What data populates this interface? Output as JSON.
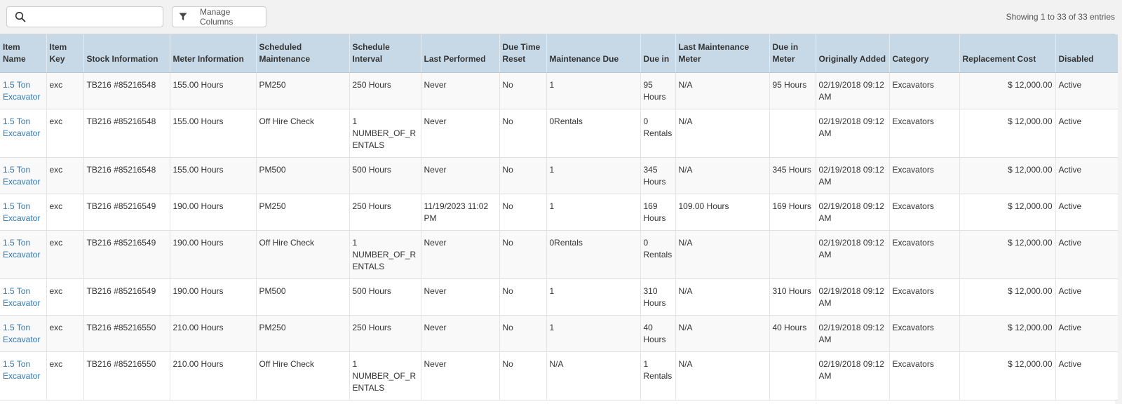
{
  "toolbar": {
    "search_value": "",
    "search_placeholder": "",
    "manage_columns_label": "Manage Columns",
    "entries_info": "Showing 1 to 33 of 33 entries"
  },
  "icons": {
    "search": "search-icon",
    "filter": "filter-icon"
  },
  "colors": {
    "link": "#2a7ab8",
    "header_bg": "#c7d9e6",
    "toolbar_bg": "#f2f2f2"
  },
  "table": {
    "columns": [
      "Item Name",
      "Item Key",
      "Stock Information",
      "Meter Information",
      "Scheduled Maintenance",
      "Schedule Interval",
      "Last Performed",
      "Due Time Reset",
      "Maintenance Due",
      "Due in",
      "Last Maintenance Meter",
      "Due in Meter",
      "Originally Added",
      "Category",
      "Replacement Cost",
      "Disabled"
    ],
    "rows": [
      [
        "1.5 Ton Excavator",
        "exc",
        "TB216 #85216548",
        "155.00 Hours",
        "PM250",
        "250 Hours",
        "Never",
        "No",
        "1",
        "95 Hours",
        "N/A",
        "95 Hours",
        "02/19/2018 09:12 AM",
        "Excavators",
        "$ 12,000.00",
        "Active"
      ],
      [
        "1.5 Ton Excavator",
        "exc",
        "TB216 #85216548",
        "155.00 Hours",
        "Off Hire Check",
        "1 NUMBER_OF_RENTALS",
        "Never",
        "No",
        "0Rentals",
        "0 Rentals",
        "N/A",
        "",
        "02/19/2018 09:12 AM",
        "Excavators",
        "$ 12,000.00",
        "Active"
      ],
      [
        "1.5 Ton Excavator",
        "exc",
        "TB216 #85216548",
        "155.00 Hours",
        "PM500",
        "500 Hours",
        "Never",
        "No",
        "1",
        "345 Hours",
        "N/A",
        "345 Hours",
        "02/19/2018 09:12 AM",
        "Excavators",
        "$ 12,000.00",
        "Active"
      ],
      [
        "1.5 Ton Excavator",
        "exc",
        "TB216 #85216549",
        "190.00 Hours",
        "PM250",
        "250 Hours",
        "11/19/2023 11:02 PM",
        "No",
        "1",
        "169 Hours",
        "109.00 Hours",
        "169 Hours",
        "02/19/2018 09:12 AM",
        "Excavators",
        "$ 12,000.00",
        "Active"
      ],
      [
        "1.5 Ton Excavator",
        "exc",
        "TB216 #85216549",
        "190.00 Hours",
        "Off Hire Check",
        "1 NUMBER_OF_RENTALS",
        "Never",
        "No",
        "0Rentals",
        "0 Rentals",
        "N/A",
        "",
        "02/19/2018 09:12 AM",
        "Excavators",
        "$ 12,000.00",
        "Active"
      ],
      [
        "1.5 Ton Excavator",
        "exc",
        "TB216 #85216549",
        "190.00 Hours",
        "PM500",
        "500 Hours",
        "Never",
        "No",
        "1",
        "310 Hours",
        "N/A",
        "310 Hours",
        "02/19/2018 09:12 AM",
        "Excavators",
        "$ 12,000.00",
        "Active"
      ],
      [
        "1.5 Ton Excavator",
        "exc",
        "TB216 #85216550",
        "210.00 Hours",
        "PM250",
        "250 Hours",
        "Never",
        "No",
        "1",
        "40 Hours",
        "N/A",
        "40 Hours",
        "02/19/2018 09:12 AM",
        "Excavators",
        "$ 12,000.00",
        "Active"
      ],
      [
        "1.5 Ton Excavator",
        "exc",
        "TB216 #85216550",
        "210.00 Hours",
        "Off Hire Check",
        "1 NUMBER_OF_RENTALS",
        "Never",
        "No",
        "N/A",
        "1 Rentals",
        "N/A",
        "",
        "02/19/2018 09:12 AM",
        "Excavators",
        "$ 12,000.00",
        "Active"
      ]
    ]
  }
}
